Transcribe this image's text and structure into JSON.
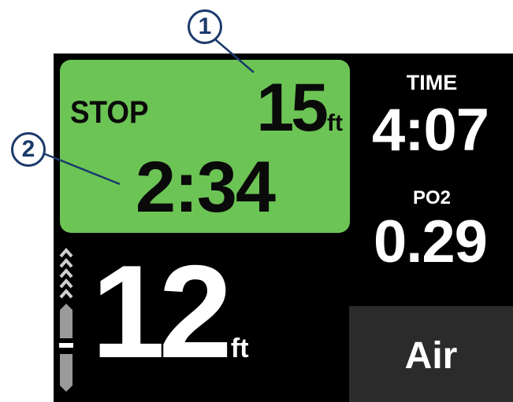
{
  "stop": {
    "label": "STOP",
    "depth_value": "15",
    "depth_unit": "ft",
    "time": "2:34",
    "color": "#6cc455"
  },
  "time": {
    "label": "TIME",
    "value": "4:07"
  },
  "po2": {
    "label": "PO2",
    "value": "0.29"
  },
  "depth": {
    "value": "12",
    "unit": "ft"
  },
  "gas": {
    "label": "Air"
  },
  "ascent_indicator": {
    "icon": "ascent-rate-chevrons-icon"
  },
  "callouts": [
    {
      "number": "1"
    },
    {
      "number": "2"
    }
  ]
}
